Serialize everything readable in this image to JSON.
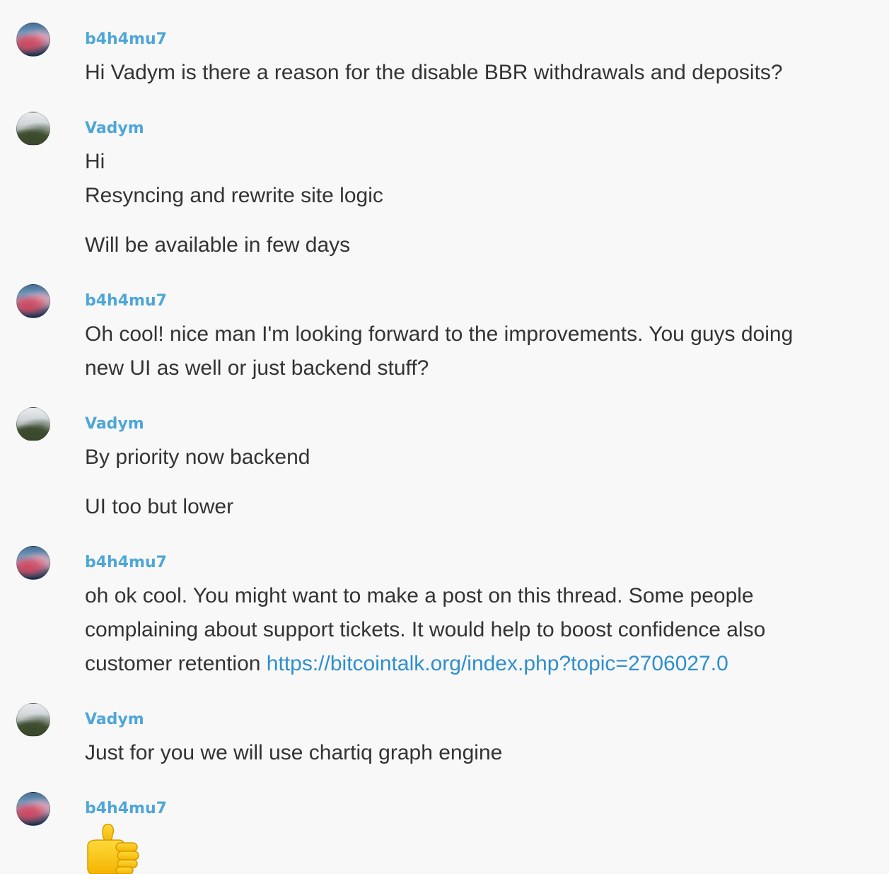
{
  "messages": [
    {
      "author": "b4h4mu7",
      "avatar_icon": "sunset-avatar",
      "lines": [
        "Hi Vadym is there a reason for the disable BBR withdrawals and deposits?"
      ]
    },
    {
      "author": "Vadym",
      "avatar_icon": "mountain-avatar",
      "lines": [
        "Hi",
        "Resyncing and rewrite site logic",
        "Will be available in few days"
      ]
    },
    {
      "author": "b4h4mu7",
      "avatar_icon": "sunset-avatar",
      "lines": [
        "Oh cool! nice man I'm looking forward to the improvements. You guys doing",
        "new UI as well or just backend stuff?"
      ]
    },
    {
      "author": "Vadym",
      "avatar_icon": "mountain-avatar",
      "lines": [
        "By priority now backend",
        "UI too but lower"
      ]
    },
    {
      "author": "b4h4mu7",
      "avatar_icon": "sunset-avatar",
      "lines": [
        "oh ok cool. You might want to make a post on this thread. Some people",
        "complaining about support tickets. It would help to boost confidence also",
        "customer retention "
      ],
      "link": "https://bitcointalk.org/index.php?topic=2706027.0"
    },
    {
      "author": "Vadym",
      "avatar_icon": "mountain-avatar",
      "lines": [
        "Just for you we will use chartiq graph engine"
      ]
    },
    {
      "author": "b4h4mu7",
      "avatar_icon": "sunset-avatar",
      "emoji": "thumbs-up-emoji"
    }
  ],
  "colors": {
    "background": "#f8f8f8",
    "username": "#4ea6d8",
    "text": "#333333",
    "link": "#2e8fcf"
  }
}
